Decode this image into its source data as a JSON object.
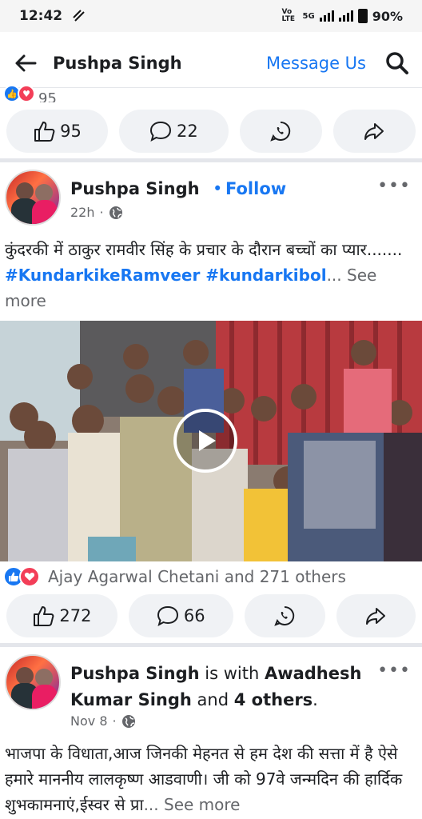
{
  "status_bar": {
    "time": "12:42",
    "network": "Vo LTE",
    "signal": "5G",
    "battery": "90%"
  },
  "header": {
    "title": "Pushpa Singh",
    "message_label": "Message Us"
  },
  "top_post": {
    "reaction_count_partial": "95",
    "likes": "95",
    "comments": "22"
  },
  "post1": {
    "author": "Pushpa Singh",
    "follow_label": "Follow",
    "time": "22h",
    "text": "कुंदरकी में ठाकुर रामवीर सिंह के प्रचार के दौरान बच्चों का प्यार.......",
    "hashtags": "#KundarkikeRamveer #kundarkibol",
    "see_more": "... See more",
    "reaction_summary": "Ajay Agarwal Chetani and 271 others",
    "likes": "272",
    "comments": "66"
  },
  "post2": {
    "author": "Pushpa Singh",
    "with_text": "is with",
    "tagged": "Awadhesh Kumar Singh",
    "and_text": "and",
    "others": "4 others",
    "period": ".",
    "time": "Nov 8",
    "text": "भाजपा के विधाता,आज जिनकी मेहनत से हम देश की सत्ता में है ऐसे हमारे माननीय लालकृष्ण आडवाणी। जी को 97वे जन्मदिन की हार्दिक शुभकामनाएं,ईस्वर से प्रा",
    "see_more": "... See more"
  },
  "colors": {
    "accent": "#1877f2",
    "like": "#1877f2",
    "love": "#f33e58",
    "pill_bg": "#f0f2f5",
    "text": "#1c1e21",
    "muted": "#65676b"
  }
}
